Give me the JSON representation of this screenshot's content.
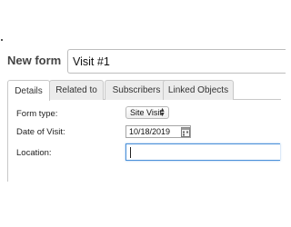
{
  "header": {
    "title": "New form",
    "name_value": "Visit #1"
  },
  "tabs": [
    {
      "label": "Details",
      "active": true
    },
    {
      "label": "Related to",
      "active": false
    },
    {
      "label": "Subscribers",
      "active": false
    },
    {
      "label": "Linked Objects",
      "active": false
    }
  ],
  "form": {
    "form_type_label": "Form type:",
    "form_type_value": "Site Visit",
    "date_label": "Date of Visit:",
    "date_value": "10/18/2019",
    "location_label": "Location:",
    "location_value": ""
  },
  "icons": {
    "select_arrows": "up-down-arrows-icon",
    "date_picker": "calendar-icon"
  },
  "colors": {
    "focus_border": "#4a90d9",
    "active_tab": "#ffffff",
    "inactive_tab": "#ececec"
  }
}
